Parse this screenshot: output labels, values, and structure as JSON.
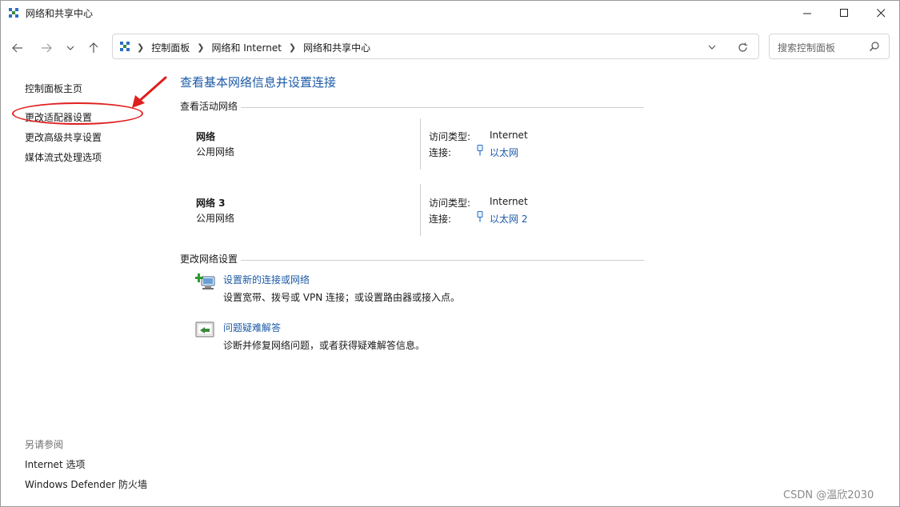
{
  "window": {
    "title": "网络和共享中心"
  },
  "nav": {
    "breadcrumbs": [
      "控制面板",
      "网络和 Internet",
      "网络和共享中心"
    ],
    "search_placeholder": "搜索控制面板"
  },
  "sidebar": {
    "links": [
      {
        "label": "控制面板主页"
      },
      {
        "label": "更改适配器设置"
      },
      {
        "label": "更改高级共享设置"
      },
      {
        "label": "媒体流式处理选项"
      }
    ],
    "see_also_title": "另请参阅",
    "see_also": [
      {
        "label": "Internet 选项"
      },
      {
        "label": "Windows Defender 防火墙"
      }
    ]
  },
  "main": {
    "heading": "查看基本网络信息并设置连接",
    "active_networks_title": "查看活动网络",
    "networks": [
      {
        "name": "网络",
        "category": "公用网络",
        "access_label": "访问类型:",
        "access_value": "Internet",
        "conn_label": "连接:",
        "conn_value": "以太网"
      },
      {
        "name": "网络 3",
        "category": "公用网络",
        "access_label": "访问类型:",
        "access_value": "Internet",
        "conn_label": "连接:",
        "conn_value": "以太网 2"
      }
    ],
    "change_settings_title": "更改网络设置",
    "tasks": [
      {
        "link": "设置新的连接或网络",
        "desc": "设置宽带、拨号或 VPN 连接；或设置路由器或接入点。",
        "icon": "new-connection-icon"
      },
      {
        "link": "问题疑难解答",
        "desc": "诊断并修复网络问题，或者获得疑难解答信息。",
        "icon": "troubleshoot-icon"
      }
    ]
  },
  "watermark": "CSDN @温欣2030",
  "colors": {
    "link_blue": "#1c5aa6",
    "annotation_red": "#e01f1f"
  }
}
